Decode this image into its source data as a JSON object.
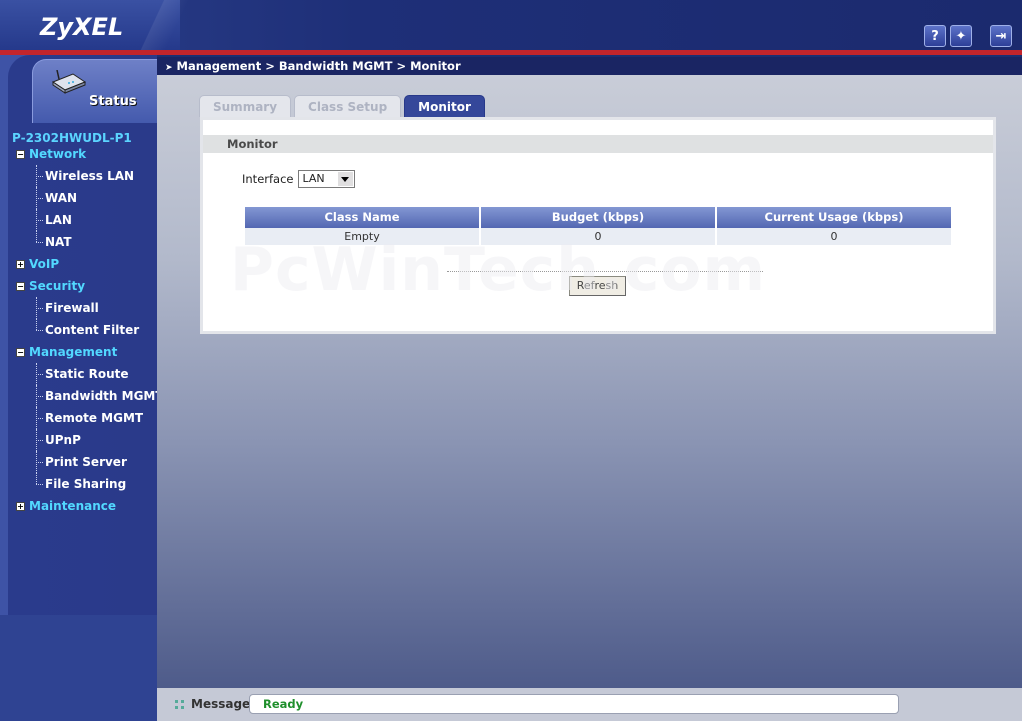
{
  "header": {
    "logo": "ZyXEL",
    "icons": [
      {
        "name": "help-icon",
        "glyph": "?"
      },
      {
        "name": "wizard-icon",
        "glyph": "✦"
      },
      {
        "name": "logout-icon",
        "glyph": "⇥"
      }
    ]
  },
  "sidebar": {
    "status_label": "Status",
    "model": "P-2302HWUDL-P1",
    "items": [
      {
        "label": "Network",
        "type": "group",
        "toggle": "−"
      },
      {
        "label": "Wireless LAN",
        "type": "child"
      },
      {
        "label": "WAN",
        "type": "child"
      },
      {
        "label": "LAN",
        "type": "child"
      },
      {
        "label": "NAT",
        "type": "child"
      },
      {
        "label": "VoIP",
        "type": "group",
        "toggle": "+"
      },
      {
        "label": "Security",
        "type": "group",
        "toggle": "−"
      },
      {
        "label": "Firewall",
        "type": "child"
      },
      {
        "label": "Content Filter",
        "type": "child"
      },
      {
        "label": "Management",
        "type": "group",
        "toggle": "−"
      },
      {
        "label": "Static Route",
        "type": "child"
      },
      {
        "label": "Bandwidth MGMT",
        "type": "child"
      },
      {
        "label": "Remote MGMT",
        "type": "child"
      },
      {
        "label": "UPnP",
        "type": "child"
      },
      {
        "label": "Print Server",
        "type": "child"
      },
      {
        "label": "File Sharing",
        "type": "child"
      },
      {
        "label": "Maintenance",
        "type": "group",
        "toggle": "+"
      }
    ]
  },
  "breadcrumb": "Management > Bandwidth MGMT > Monitor",
  "tabs": [
    {
      "label": "Summary",
      "active": false
    },
    {
      "label": "Class Setup",
      "active": false
    },
    {
      "label": "Monitor",
      "active": true
    }
  ],
  "panel": {
    "title": "Monitor",
    "interface_label": "Interface",
    "interface_value": "LAN",
    "table": {
      "headers": [
        "Class Name",
        "Budget (kbps)",
        "Current Usage (kbps)"
      ],
      "rows": [
        [
          "Empty",
          "0",
          "0"
        ]
      ]
    },
    "refresh_label": "Refresh"
  },
  "watermark": "PcWinTech.com",
  "statusbar": {
    "label": "Message",
    "value": "Ready"
  },
  "colors": {
    "accent": "#35479a",
    "group_link": "#52d8ff",
    "banner_stripe": "#c3252c",
    "status_ok": "#1f8f2c"
  }
}
